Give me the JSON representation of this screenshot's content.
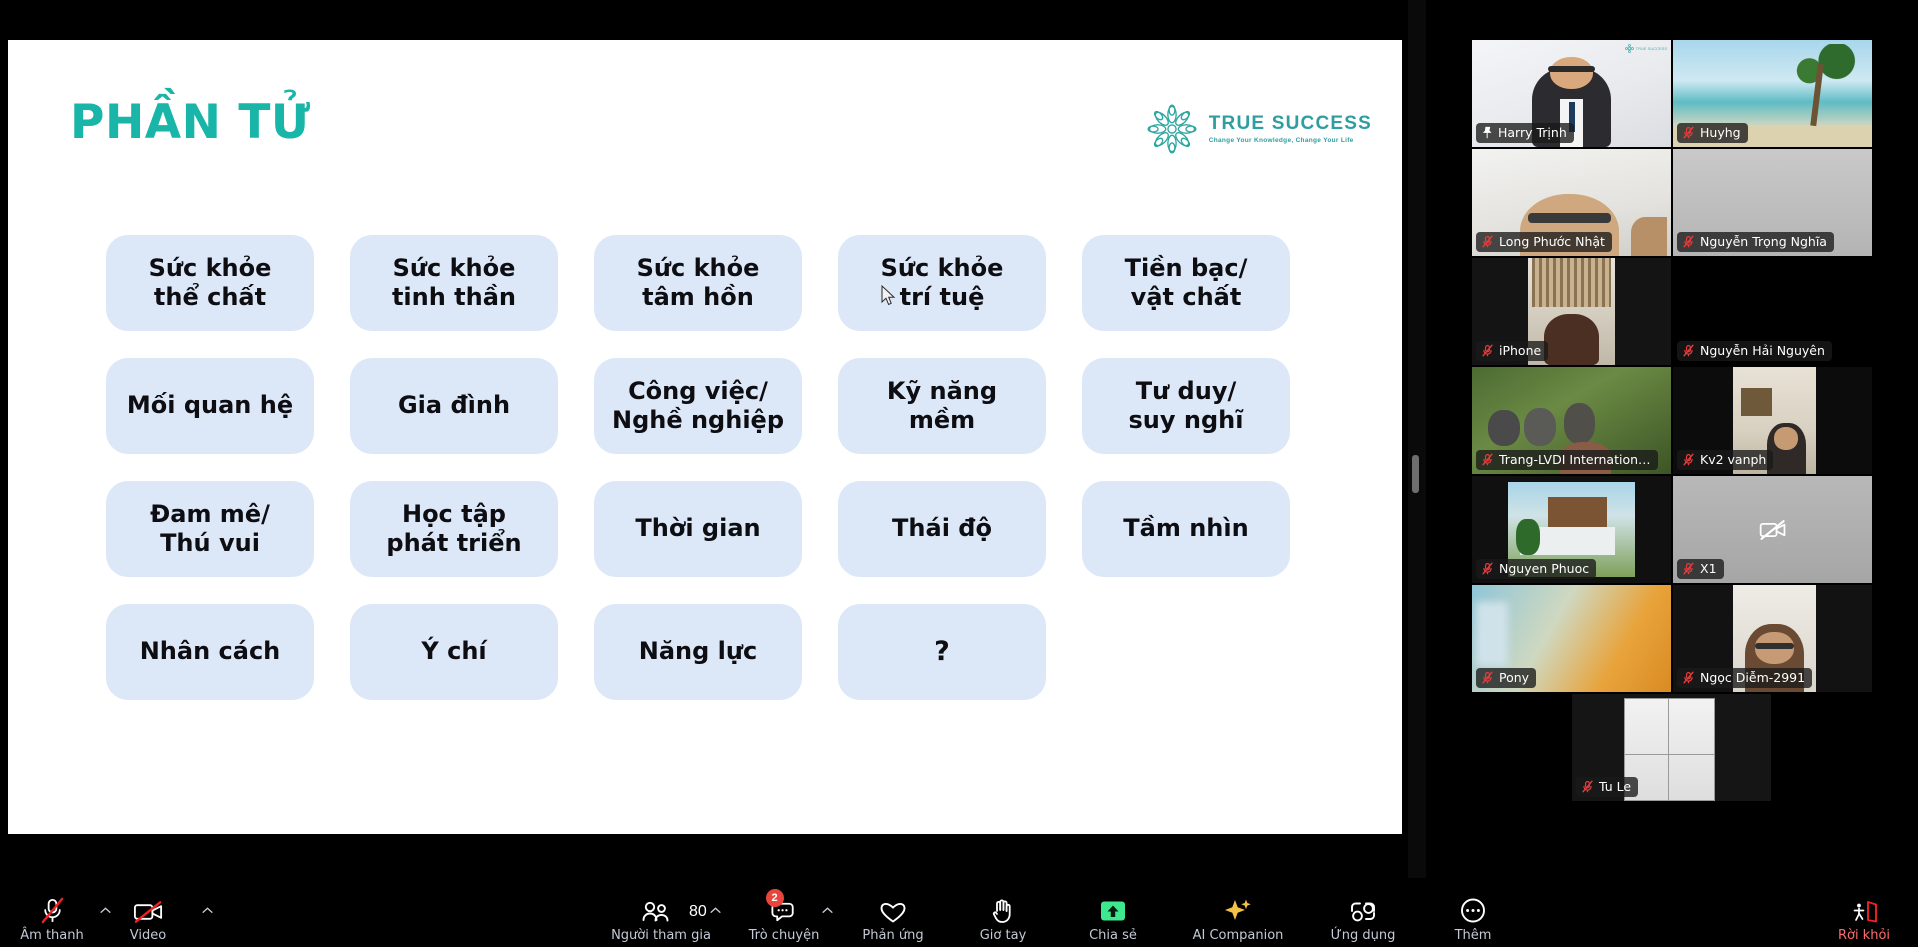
{
  "slide": {
    "title": "PHẦN TỬ",
    "logo": {
      "name": "TRUE SUCCESS",
      "tagline": "Change Your Knowledge, Change Your Life",
      "mark_icon": "flower-mandala-icon",
      "color": "#2e9ea0"
    },
    "accent_color": "#19b5a8",
    "cell_color": "#dce8f8",
    "cells": [
      "Sức khỏe\nthể chất",
      "Sức khỏe\ntinh thần",
      "Sức khỏe\ntâm hồn",
      "Sức khỏe\ntrí tuệ",
      "Tiền bạc/\nvật chất",
      "Mối quan hệ",
      "Gia đình",
      "Công việc/\nNghề nghiệp",
      "Kỹ năng\nmềm",
      "Tư duy/\nsuy nghĩ",
      "Đam mê/\nThú vui",
      "Học tập\nphát triển",
      "Thời gian",
      "Thái độ",
      "Tầm nhìn",
      "Nhân cách",
      "Ý chí",
      "Năng lực",
      "?",
      ""
    ]
  },
  "gallery": {
    "participants": [
      {
        "name": "Harry Trịnh",
        "muted": false,
        "pinned": true,
        "speaking": true,
        "video": "person-presenter",
        "has_logo": true
      },
      {
        "name": "Huyhg",
        "muted": true,
        "pinned": false,
        "speaking": false,
        "video": "beach-palm-background",
        "has_logo": false
      },
      {
        "name": "Long Phước Nhật",
        "muted": true,
        "pinned": false,
        "speaking": false,
        "video": "person-bald-glasses",
        "has_logo": false
      },
      {
        "name": "Nguyễn Trọng Nghĩa",
        "muted": true,
        "pinned": false,
        "speaking": false,
        "video": "gray-blank",
        "has_logo": false
      },
      {
        "name": "iPhone",
        "muted": true,
        "pinned": false,
        "speaking": false,
        "video": "person-window-curtain",
        "has_logo": false
      },
      {
        "name": "Nguyễn Hải Nguyên",
        "muted": true,
        "pinned": false,
        "speaking": false,
        "video": "black-blank",
        "has_logo": false
      },
      {
        "name": "Trang-LVDI Internation…",
        "muted": true,
        "pinned": false,
        "speaking": false,
        "video": "monkeys-forest",
        "has_logo": false
      },
      {
        "name": "Kv2 vanph",
        "muted": true,
        "pinned": false,
        "speaking": false,
        "video": "person-indoor-room",
        "has_logo": false
      },
      {
        "name": "Nguyen Phuoc",
        "muted": true,
        "pinned": false,
        "speaking": false,
        "video": "modern-house",
        "has_logo": false
      },
      {
        "name": "X1",
        "muted": true,
        "pinned": false,
        "speaking": false,
        "video": "camera-off",
        "has_logo": false
      },
      {
        "name": "Pony",
        "muted": true,
        "pinned": false,
        "speaking": false,
        "video": "blurred-orange",
        "has_logo": false
      },
      {
        "name": "Ngọc Diễm-2991",
        "muted": true,
        "pinned": false,
        "speaking": false,
        "video": "person-glasses-woman",
        "has_logo": false
      },
      {
        "name": "Tu Le",
        "muted": true,
        "pinned": false,
        "speaking": false,
        "video": "white-cabinet",
        "has_logo": false
      }
    ]
  },
  "toolbar": {
    "audio": {
      "label": "Âm thanh",
      "icon": "microphone-muted-icon",
      "muted": true,
      "has_caret": true
    },
    "video": {
      "label": "Video",
      "icon": "camera-off-icon",
      "off": true,
      "has_caret": true
    },
    "participants": {
      "label": "Người tham gia",
      "icon": "people-icon",
      "count": "80",
      "has_caret": true
    },
    "chat": {
      "label": "Trò chuyện",
      "icon": "chat-bubble-icon",
      "badge": "2",
      "has_caret": true
    },
    "reactions": {
      "label": "Phản ứng",
      "icon": "heart-icon"
    },
    "raise_hand": {
      "label": "Giơ tay",
      "icon": "raised-hand-icon"
    },
    "share": {
      "label": "Chia sẻ",
      "icon": "share-screen-icon",
      "active_color": "#3ee88f"
    },
    "ai": {
      "label": "AI Companion",
      "icon": "sparkle-icon",
      "color": "#f5c249"
    },
    "apps": {
      "label": "Ứng dụng",
      "icon": "apps-icon"
    },
    "more": {
      "label": "Thêm",
      "icon": "ellipsis-circle-icon"
    },
    "leave": {
      "label": "Rời khỏi",
      "icon": "leave-door-icon",
      "color": "#ff4a4a"
    }
  }
}
